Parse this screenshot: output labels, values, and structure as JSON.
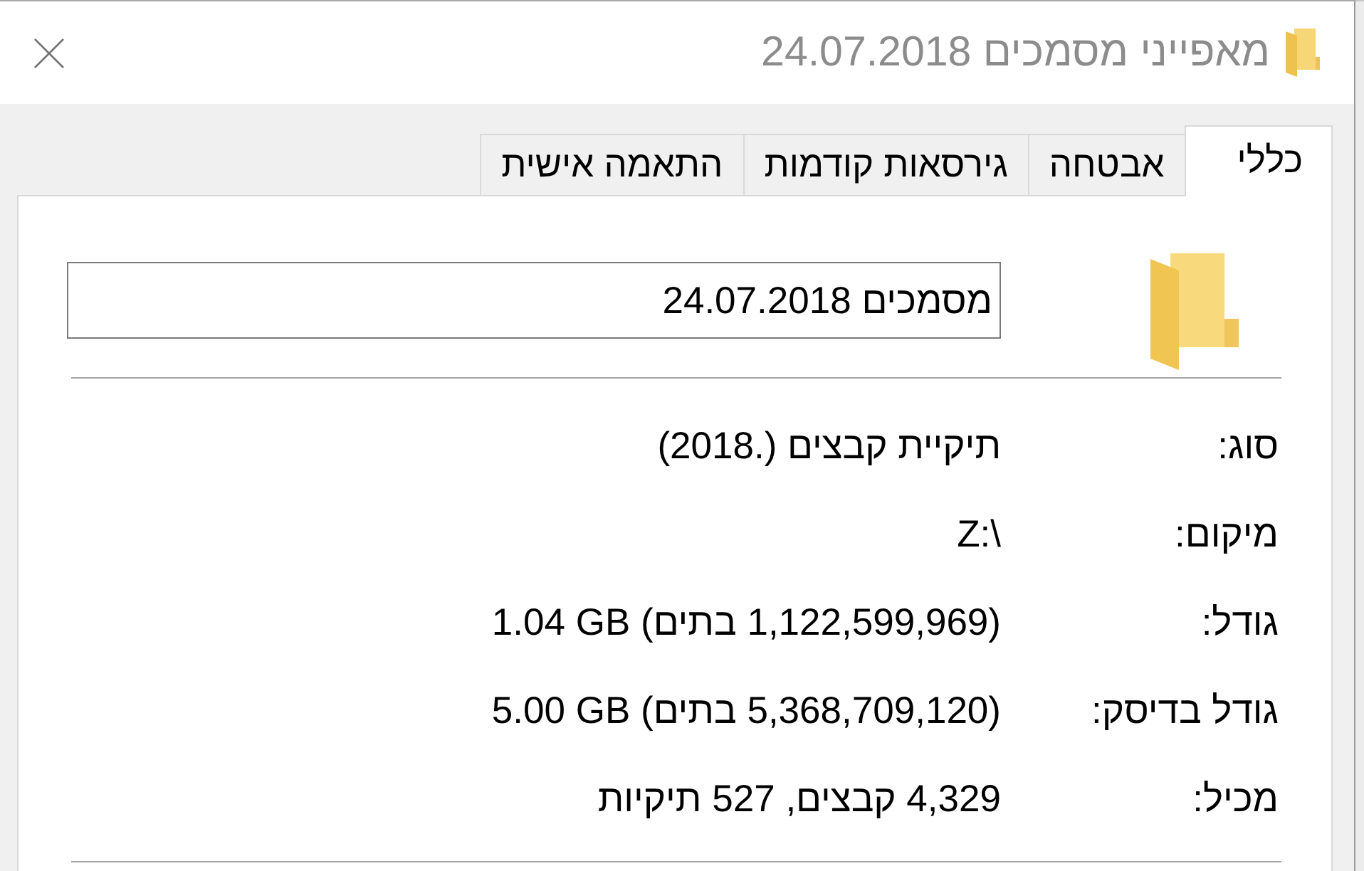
{
  "window": {
    "title": "מאפייני מסמכים 24.07.2018"
  },
  "tabs": [
    {
      "label": "כללי",
      "selected": true
    },
    {
      "label": "אבטחה",
      "selected": false
    },
    {
      "label": "גירסאות קודמות",
      "selected": false
    },
    {
      "label": "התאמה אישית",
      "selected": false
    }
  ],
  "general": {
    "name_field": {
      "value": "מסמכים 24.07.2018"
    },
    "properties": [
      {
        "label": "סוג:",
        "value": "תיקיית קבצים (.2018)"
      },
      {
        "label": "מיקום:",
        "value": "Z:\\"
      },
      {
        "label": "גודל:",
        "value": "1.04 GB (‏1,122,599,969 בתים)"
      },
      {
        "label": "גודל בדיסק:",
        "value": "5.00 GB (‏5,368,709,120 בתים)"
      },
      {
        "label": "מכיל:",
        "value": "4,329 קבצים, 527 תיקיות"
      }
    ]
  }
}
